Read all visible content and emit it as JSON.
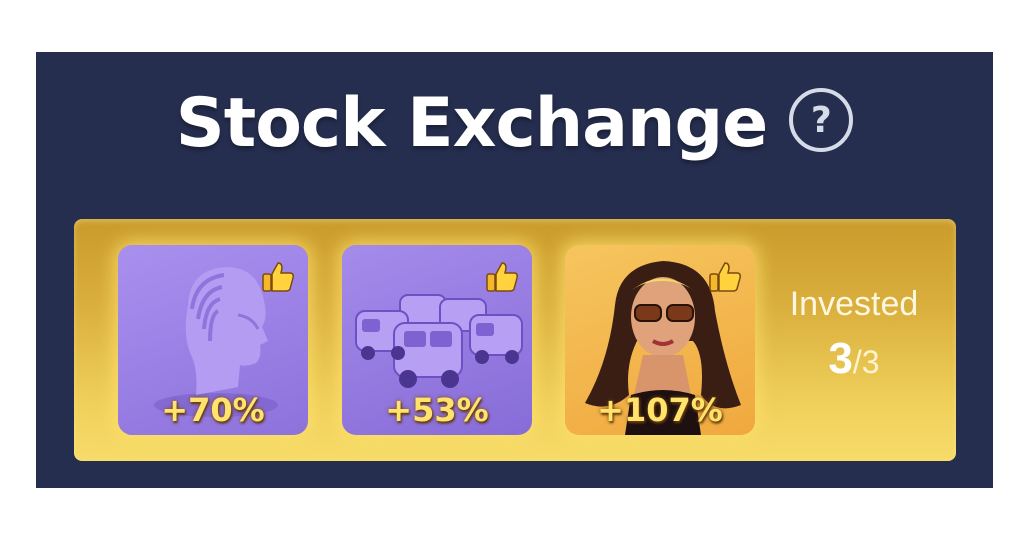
{
  "header": {
    "title": "Stock Exchange",
    "help_label": "?"
  },
  "stocks": [
    {
      "name": "ai-head",
      "change": "+70%",
      "liked": true
    },
    {
      "name": "delivery-vans",
      "change": "+53%",
      "liked": true
    },
    {
      "name": "influencer",
      "change": "+107%",
      "liked": true
    }
  ],
  "invested": {
    "label": "Invested",
    "count": "3",
    "separator": "/",
    "total": "3"
  },
  "colors": {
    "panel": "#262e50",
    "strip_gold": "#e6c04c",
    "card_purple": "#9a80e4",
    "card_orange": "#f3b44a",
    "pct_yellow": "#ffe36a"
  }
}
